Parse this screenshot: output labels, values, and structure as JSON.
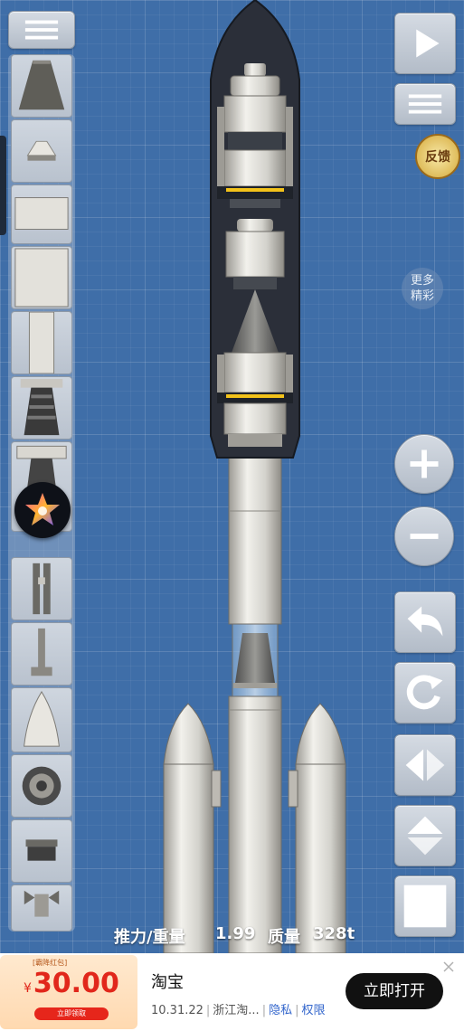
{
  "app": {
    "stats": {
      "twr_label": "推力/重量",
      "twr_value": "1.99",
      "mass_label": "质量",
      "mass_value": "328t"
    },
    "toolbar": {
      "menu_icon": "hamburger-icon",
      "play_icon": "play-icon",
      "list_icon": "list-icon",
      "zoom_in_icon": "plus-icon",
      "zoom_out_icon": "minus-icon",
      "undo_icon": "undo-icon",
      "rotate_icon": "rotate-icon",
      "flip_h_icon": "flip-horizontal-icon",
      "flip_v_icon": "flip-vertical-icon",
      "stop_icon": "square-icon"
    },
    "feedback_label": "反馈",
    "more": {
      "line1": "更多",
      "line2": "精彩"
    },
    "parts": [
      "nose-cone-part",
      "small-cone-part",
      "tank-short-part",
      "tank-tall-part",
      "tank-slim-part",
      "engine-large-part",
      "engine-medium-part",
      "separator-part",
      "strut-part",
      "fuel-pipe-part",
      "fairing-part",
      "parachute-part",
      "docking-port-part",
      "rcs-part"
    ]
  },
  "ad": {
    "coupon_tag": "[霸降红包]",
    "currency": "¥",
    "amount": "30.00",
    "claim_label": "立即领取",
    "title": "淘宝",
    "version": "10.31.22",
    "developer": "浙江淘...",
    "privacy_label": "隐私",
    "permission_label": "权限",
    "open_label": "立即打开",
    "close_icon": "close-icon"
  },
  "colors": {
    "background": "#3f6ea8",
    "fairing_dark": "#2a2f3a",
    "metal": "#d8d7d2",
    "stripe": "#f2c21a",
    "coupon_red": "#e1271b"
  }
}
